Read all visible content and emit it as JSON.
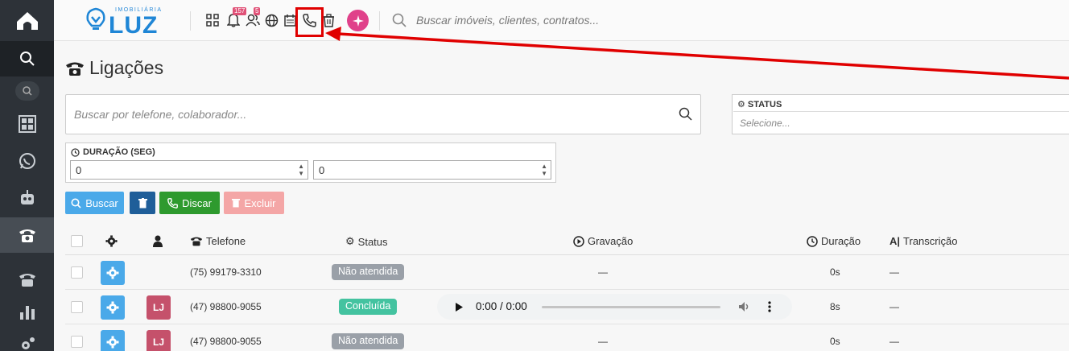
{
  "brand": {
    "small": "IMOBILIÁRIA",
    "name": "LUZ"
  },
  "topbar": {
    "notifications_badge": "157",
    "users_badge": "5",
    "search_placeholder": "Buscar imóveis, clientes, contratos..."
  },
  "page": {
    "title": "Ligações",
    "search_placeholder": "Buscar por telefone, colaborador...",
    "status_label": "STATUS",
    "status_placeholder": "Selecione...",
    "duration_label": "DURAÇÃO (SEG)",
    "duration_min": "0",
    "duration_max": "0"
  },
  "buttons": {
    "search": "Buscar",
    "dial": "Discar",
    "delete": "Excluir"
  },
  "table": {
    "headers": {
      "phone": "Telefone",
      "status": "Status",
      "recording": "Gravação",
      "duration": "Duração",
      "transcription": "Transcrição"
    },
    "rows": [
      {
        "avatar": "",
        "phone": "(75) 99179-3310",
        "status": "Não atendida",
        "recording": "—",
        "duration": "0s",
        "transcription": "—"
      },
      {
        "avatar": "LJ",
        "phone": "(47) 98800-9055",
        "status": "Concluída",
        "recording": "0:00 / 0:00",
        "duration": "8s",
        "transcription": "—"
      },
      {
        "avatar": "LJ",
        "phone": "(47) 98800-9055",
        "status": "Não atendida",
        "recording": "—",
        "duration": "0s",
        "transcription": "—"
      }
    ]
  },
  "colors": {
    "accent_blue": "#4aa9e9",
    "dark_blue": "#1f5e99",
    "green": "#2e9a2e",
    "danger_light": "#f4a6a6",
    "status_missed": "#9aa0a8",
    "status_done": "#44c3a0",
    "arrow": "#e00000"
  }
}
